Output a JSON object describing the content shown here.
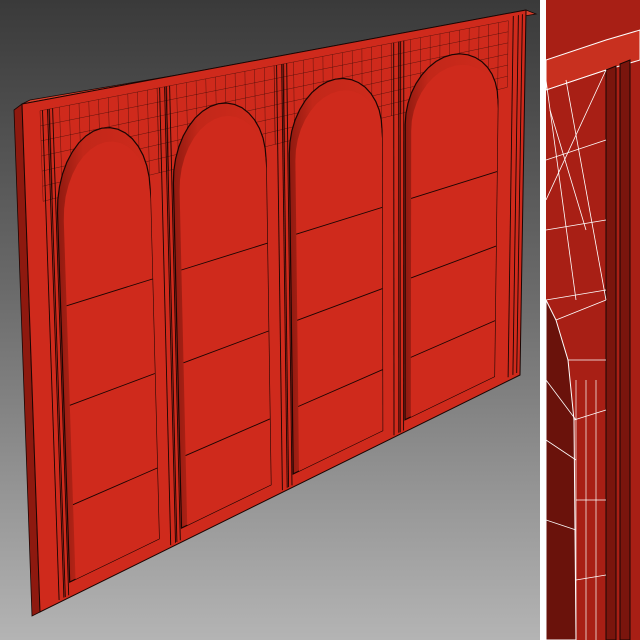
{
  "scene": {
    "description_free": true,
    "views": [
      {
        "id": "main",
        "shading": "wireframe-on-shaded",
        "object_color": "#cf2a1c",
        "wire_color": "#000000"
      },
      {
        "id": "detail",
        "shading": "wireframe-on-shaded",
        "object_color": "#b8231a",
        "wire_color": "#ffffff"
      }
    ],
    "object": {
      "kind": "arched-wall-panel",
      "arch_count": 4
    },
    "colors": {
      "bg_top": "#444444",
      "bg_bottom": "#b0b0b0",
      "face": "#cf2a1c",
      "face_shadow": "#9e1c12",
      "face_light": "#e03a26",
      "wire_dark": "#1a0503",
      "wire_light": "#ffffff"
    }
  }
}
